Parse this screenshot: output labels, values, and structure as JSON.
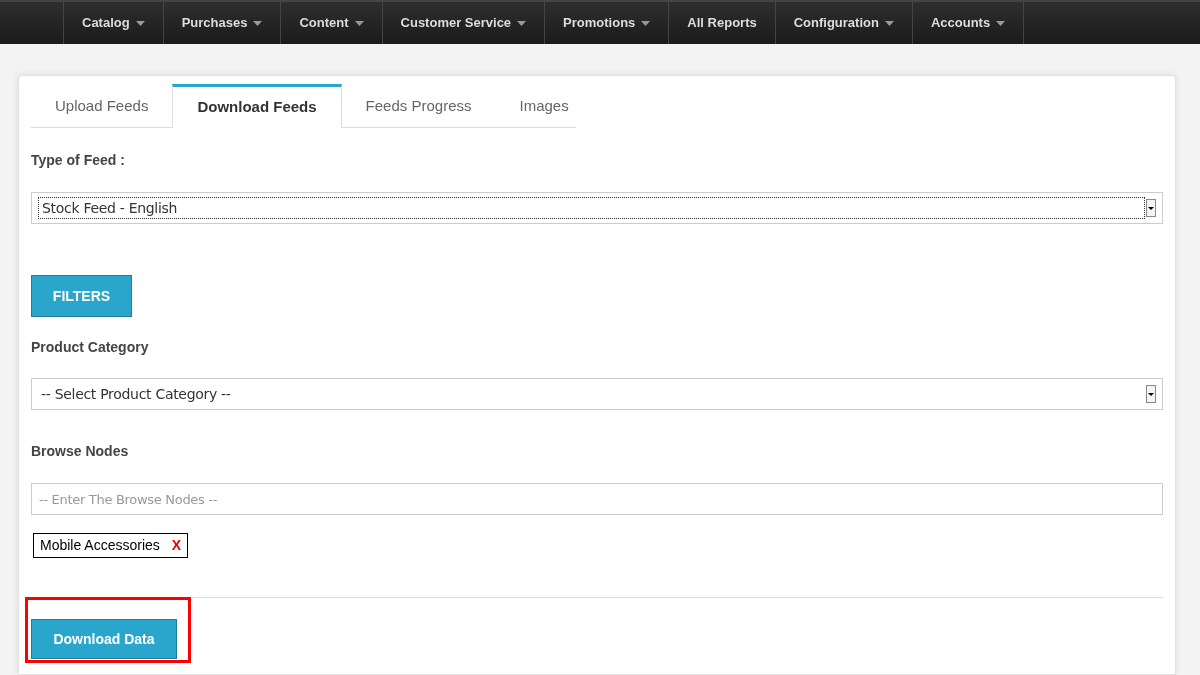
{
  "nav": [
    {
      "label": "Catalog",
      "dropdown": true
    },
    {
      "label": "Purchases",
      "dropdown": true
    },
    {
      "label": "Content",
      "dropdown": true
    },
    {
      "label": "Customer Service",
      "dropdown": true
    },
    {
      "label": "Promotions",
      "dropdown": true
    },
    {
      "label": "All Reports",
      "dropdown": false
    },
    {
      "label": "Configuration",
      "dropdown": true
    },
    {
      "label": "Accounts",
      "dropdown": true
    }
  ],
  "tabs": [
    {
      "label": "Upload Feeds",
      "selected": false
    },
    {
      "label": "Download Feeds",
      "selected": true
    },
    {
      "label": "Feeds Progress",
      "selected": false
    },
    {
      "label": "Images",
      "selected": false
    }
  ],
  "feed_type": {
    "label": "Type of Feed :",
    "value": "Stock Feed - English"
  },
  "filters_button": "FILTERS",
  "product_category": {
    "label": "Product Category",
    "value": "-- Select Product Category --"
  },
  "browse_nodes": {
    "label": "Browse Nodes",
    "placeholder": "-- Enter The Browse Nodes --"
  },
  "tags": [
    {
      "label": "Mobile Accessories",
      "remove": "X"
    }
  ],
  "download_button": "Download Data"
}
